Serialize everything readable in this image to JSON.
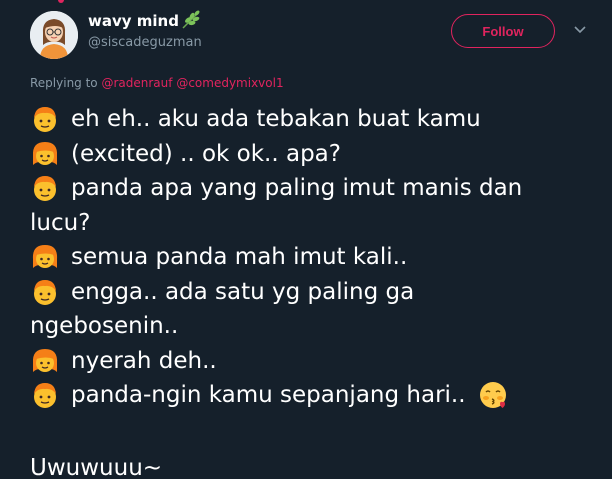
{
  "tweet": {
    "display_name": "wavy mind",
    "handle": "@siscadeguzman",
    "follow_label": "Follow",
    "replying_to_label": "Replying to",
    "replying_to_mentions": [
      "@radenrauf",
      "@comedymixvol1"
    ],
    "lines": [
      {
        "emoji": "boy-icon",
        "text": "eh eh.. aku ada tebakan buat kamu"
      },
      {
        "emoji": "girl-icon",
        "text": "(excited) .. ok ok.. apa?"
      },
      {
        "emoji": "boy-icon",
        "text": "panda apa yang paling imut manis dan"
      },
      {
        "emoji": null,
        "text": "lucu?"
      },
      {
        "emoji": "girl-icon",
        "text": "semua panda mah imut kali.."
      },
      {
        "emoji": "boy-icon",
        "text": "engga.. ada satu yg paling ga"
      },
      {
        "emoji": null,
        "text": "ngebosenin.."
      },
      {
        "emoji": "girl-icon",
        "text": "nyerah deh.."
      },
      {
        "emoji": "boy-icon",
        "text": "panda-ngin kamu sepanjang hari..",
        "trailing_emoji": "kissing-face-icon"
      }
    ],
    "final_text": "Uwuwuuu~"
  },
  "colors": {
    "background": "#15202b",
    "accent": "#e0245e",
    "secondary_text": "#8899a6",
    "primary_text": "#ffffff"
  }
}
